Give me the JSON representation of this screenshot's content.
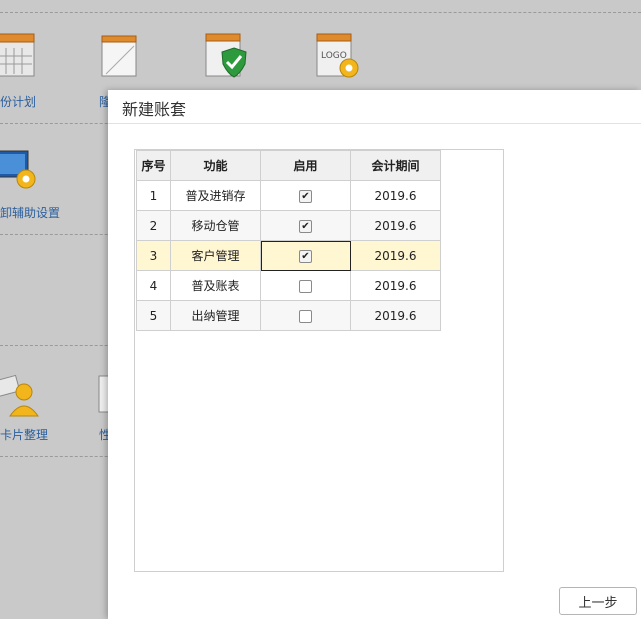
{
  "background": {
    "labels": [
      "份计划",
      "隆",
      "卸辅助设置",
      "卡片整理",
      "性"
    ],
    "logo_text": "LOGO"
  },
  "dialog": {
    "title": "新建账套",
    "columns": [
      "序号",
      "功能",
      "启用",
      "会计期间"
    ],
    "rows": [
      {
        "num": "1",
        "func": "普及进销存",
        "enabled": true,
        "period": "2019.6"
      },
      {
        "num": "2",
        "func": "移动仓管",
        "enabled": true,
        "period": "2019.6"
      },
      {
        "num": "3",
        "func": "客户管理",
        "enabled": true,
        "period": "2019.6"
      },
      {
        "num": "4",
        "func": "普及账表",
        "enabled": false,
        "period": "2019.6"
      },
      {
        "num": "5",
        "func": "出纳管理",
        "enabled": false,
        "period": "2019.6"
      }
    ],
    "selected_row": 3,
    "prev_button": "上一步",
    "check_glyph": "✔"
  }
}
